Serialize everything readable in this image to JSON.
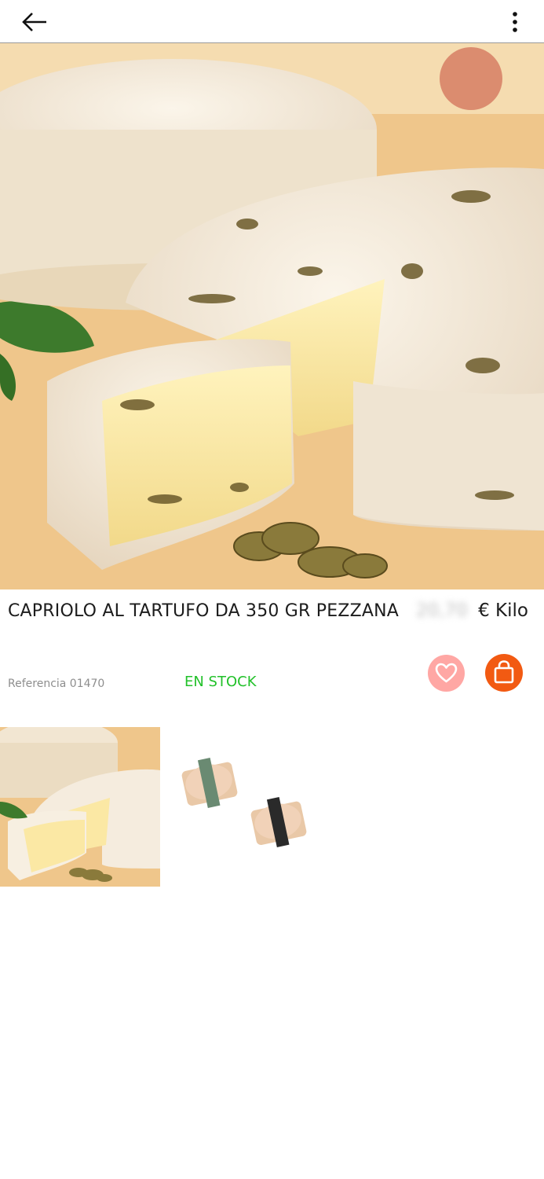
{
  "header": {
    "back_icon": "arrow-left-icon",
    "menu_icon": "more-vertical-icon"
  },
  "product": {
    "title": "CAPRIOLO AL TARTUFO DA 350 GR PEZZANA",
    "price_amount": "20,70",
    "price_unit": "€ Kilo",
    "reference": "Referencia 01470",
    "stock": "EN STOCK"
  },
  "actions": {
    "favorite_icon": "heart-icon",
    "cart_icon": "shopping-bag-icon"
  },
  "colors": {
    "stock_green": "#22c12a",
    "favorite_pink": "#ffa7a4",
    "cart_orange": "#f25a12"
  }
}
